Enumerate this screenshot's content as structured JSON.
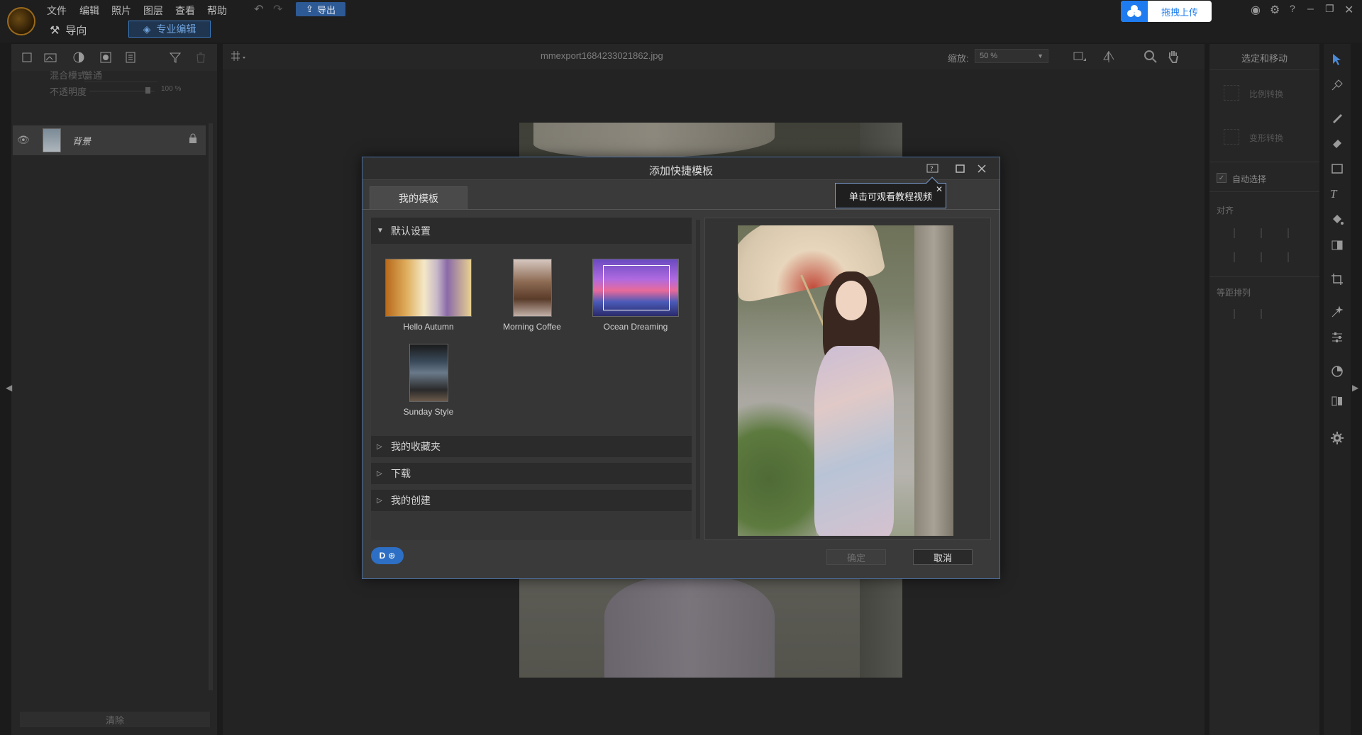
{
  "menu": {
    "items": [
      {
        "label": "文件"
      },
      {
        "label": "编辑"
      },
      {
        "label": "照片"
      },
      {
        "label": "图层"
      },
      {
        "label": "查看"
      },
      {
        "label": "帮助"
      }
    ]
  },
  "toolbar": {
    "export_label": "导出"
  },
  "modes": {
    "guide_label": "导向",
    "pro_label": "专业编辑"
  },
  "upload": {
    "label": "拖拽上传"
  },
  "layers": {
    "blend_label": "混合模式:",
    "blend_value": "普通",
    "opacity_label": "不透明度",
    "opacity_value": "100 %",
    "layer_name": "背景",
    "clear_label": "清除"
  },
  "canvas": {
    "file_name": "mmexport1684233021862.jpg",
    "zoom_label": "缩放:",
    "zoom_value": "50 %"
  },
  "right_panel": {
    "title": "选定和移动",
    "scale_transform": "比例转换",
    "warp_transform": "变形转换",
    "auto_select": "自动选择",
    "align_label": "对齐",
    "distribute_label": "等距排列"
  },
  "dialog": {
    "title": "添加快捷模板",
    "tab_label": "我的模板",
    "tooltip": "单击可观看教程视频",
    "sections": {
      "default": "默认设置",
      "favorites": "我的收藏夹",
      "downloads": "下载",
      "created": "我的创建"
    },
    "templates": [
      {
        "name": "Hello Autumn"
      },
      {
        "name": "Morning Coffee"
      },
      {
        "name": "Ocean Dreaming"
      },
      {
        "name": "Sunday Style"
      }
    ],
    "ok_label": "确定",
    "cancel_label": "取消"
  },
  "colors": {
    "accent": "#2d6fc4",
    "dialog_border": "#4b6fa0",
    "upload_blue": "#1e7cf0"
  }
}
